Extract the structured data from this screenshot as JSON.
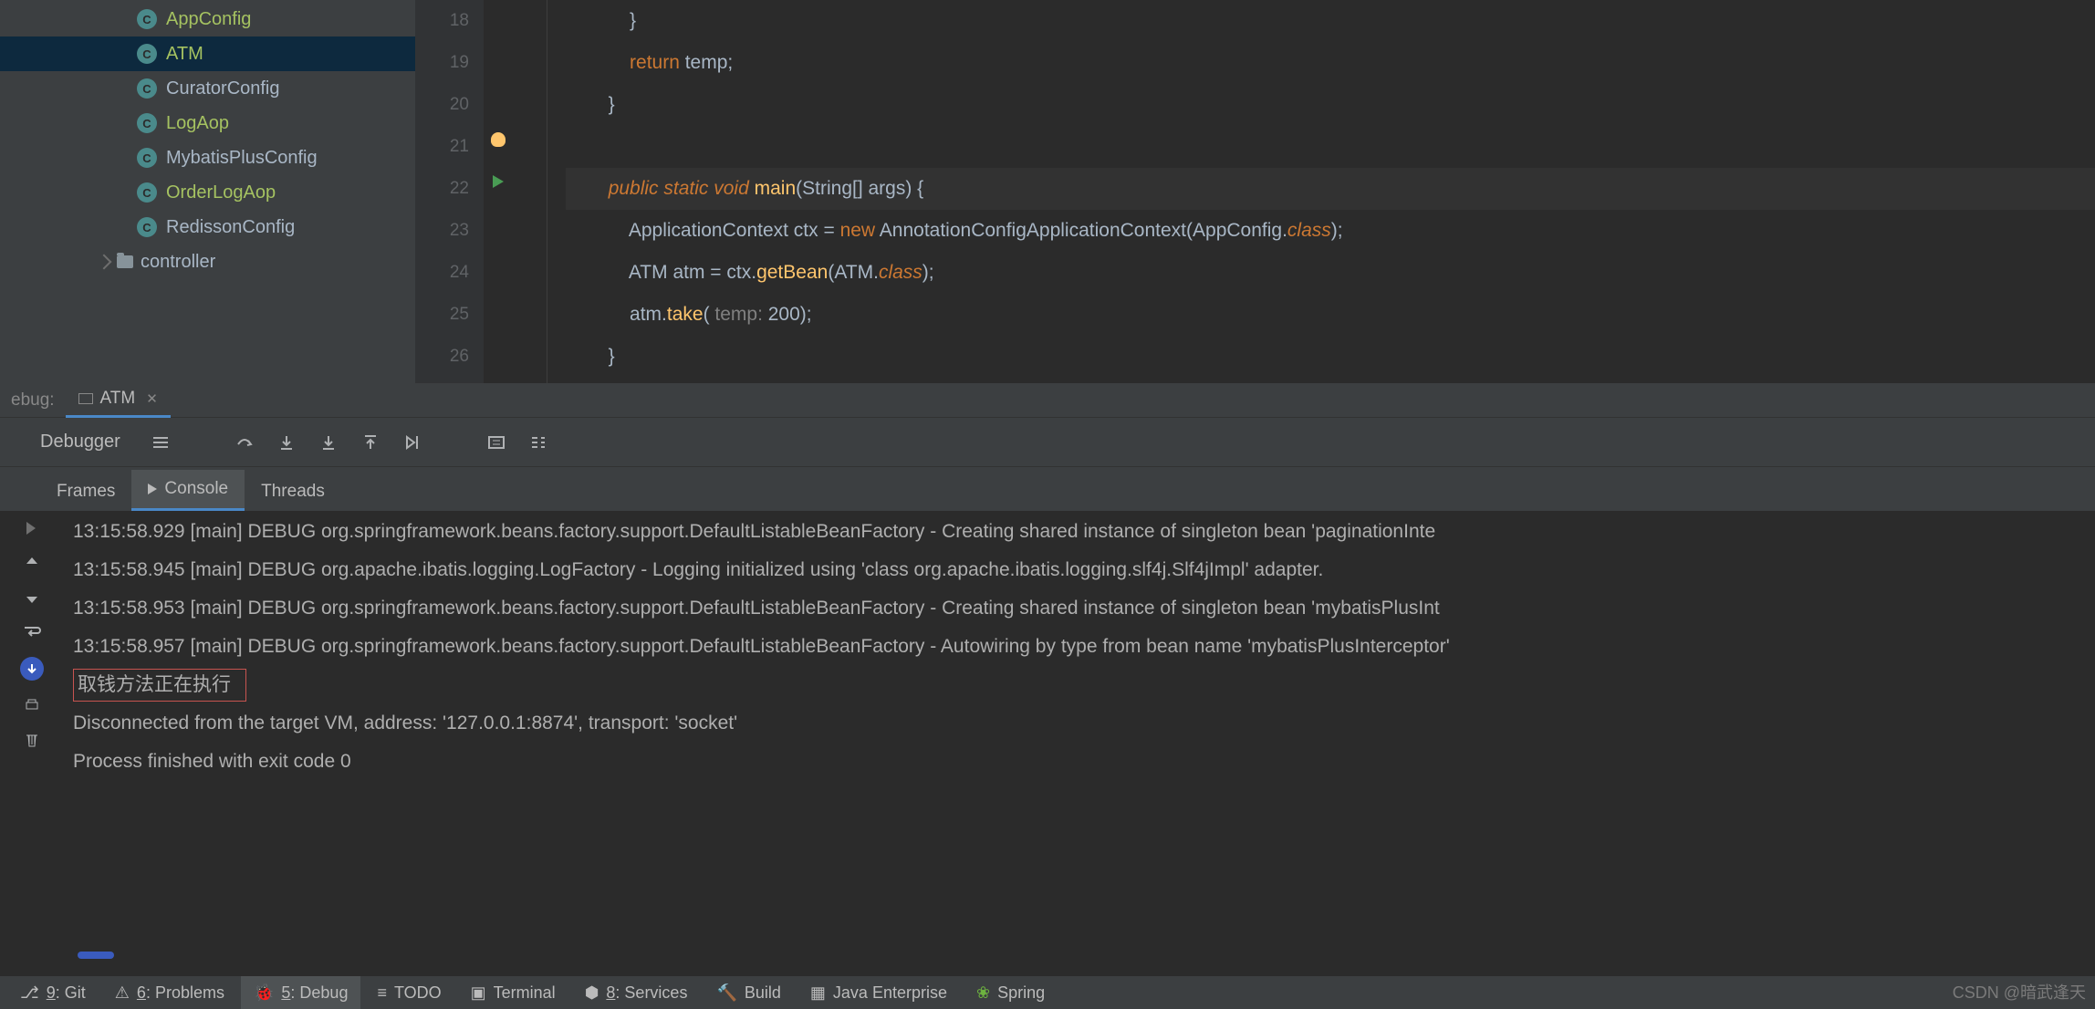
{
  "tree": {
    "items": [
      {
        "label": "AppConfig",
        "highlight": true
      },
      {
        "label": "ATM",
        "highlight": true,
        "selected": true
      },
      {
        "label": "CuratorConfig"
      },
      {
        "label": "LogAop",
        "highlight": true
      },
      {
        "label": "MybatisPlusConfig"
      },
      {
        "label": "OrderLogAop",
        "highlight": true
      },
      {
        "label": "RedissonConfig"
      }
    ],
    "folder": "controller"
  },
  "editor": {
    "lines": [
      18,
      19,
      20,
      21,
      22,
      23,
      24,
      25,
      26
    ]
  },
  "code": {
    "l18": "            }",
    "l19_kw": "return",
    "l19_rest": " temp;",
    "l20": "        }",
    "l22_pub": "public ",
    "l22_static": "static ",
    "l22_void": "void ",
    "l22_main": "main",
    "l22_args": "(String[] args) {",
    "l23_type": "ApplicationContext",
    "l23_var": " ctx = ",
    "l23_new": "new ",
    "l23_ann": "AnnotationConfigApplicationContext",
    "l23_open": "(AppConfig.",
    "l23_cls": "class",
    "l23_close": ");",
    "l24_pre": "ATM atm = ctx.",
    "l24_get": "getBean",
    "l24_mid": "(ATM.",
    "l24_cls": "class",
    "l24_end": ");",
    "l25_pre": "atm.",
    "l25_take": "take",
    "l25_open": "( ",
    "l25_hint": "temp: ",
    "l25_val": "200",
    "l25_end": ");",
    "l26": "        }"
  },
  "debug": {
    "label": "ebug:",
    "tab": "ATM",
    "debugger": "Debugger",
    "frames": "Frames",
    "console": "Console",
    "threads": "Threads"
  },
  "console": {
    "l1": "13:15:58.929 [main] DEBUG org.springframework.beans.factory.support.DefaultListableBeanFactory - Creating shared instance of singleton bean 'paginationInte",
    "l2": "13:15:58.945 [main] DEBUG org.apache.ibatis.logging.LogFactory - Logging initialized using 'class org.apache.ibatis.logging.slf4j.Slf4jImpl' adapter.",
    "l3": "13:15:58.953 [main] DEBUG org.springframework.beans.factory.support.DefaultListableBeanFactory - Creating shared instance of singleton bean 'mybatisPlusInt",
    "l4": "13:15:58.957 [main] DEBUG org.springframework.beans.factory.support.DefaultListableBeanFactory - Autowiring by type from bean name 'mybatisPlusInterceptor'",
    "l5": "取钱方法正在执行",
    "l6": "Disconnected from the target VM, address: '127.0.0.1:8874', transport: 'socket'",
    "l7": "",
    "l8": "Process finished with exit code 0"
  },
  "bottom": {
    "git": "9: Git",
    "problems": "6: Problems",
    "debug": "5: Debug",
    "todo": "TODO",
    "terminal": "Terminal",
    "services": "8: Services",
    "build": "Build",
    "javaee": "Java Enterprise",
    "spring": "Spring"
  },
  "watermark": "CSDN @暗武逢天"
}
